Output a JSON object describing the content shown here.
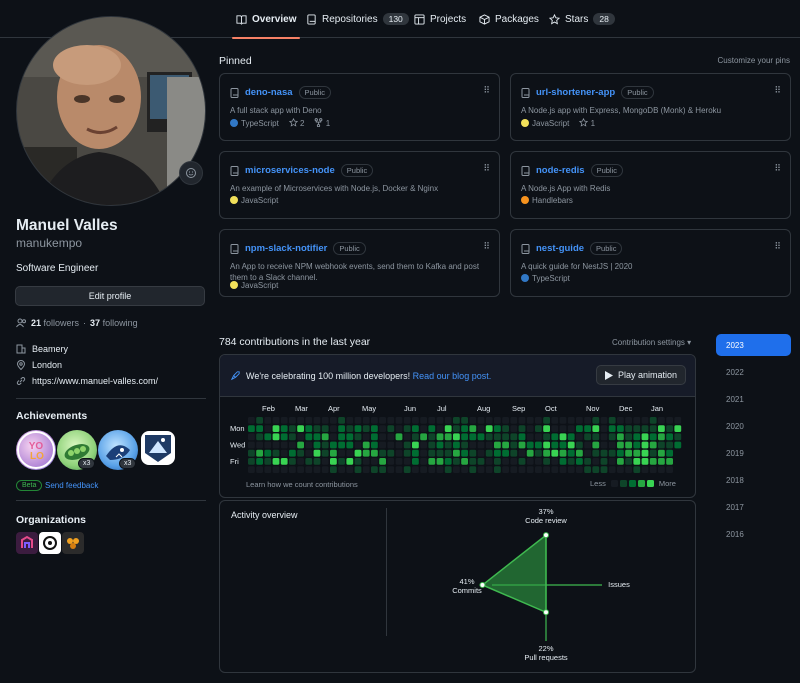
{
  "nav": {
    "tabs": [
      {
        "label": "Overview",
        "icon": "book-icon",
        "active": true
      },
      {
        "label": "Repositories",
        "icon": "repo-icon",
        "count": "130"
      },
      {
        "label": "Projects",
        "icon": "table-icon"
      },
      {
        "label": "Packages",
        "icon": "package-icon"
      },
      {
        "label": "Stars",
        "icon": "star-icon",
        "count": "28"
      }
    ]
  },
  "profile": {
    "fullname": "Manuel Valles",
    "username": "manukempo",
    "bio": "Software Engineer",
    "edit_label": "Edit profile",
    "followers_count": "21",
    "followers_label": "followers",
    "dot": "·",
    "following_count": "37",
    "following_label": "following",
    "company": "Beamery",
    "location": "London",
    "website": "https://www.manuel-valles.com/"
  },
  "achievements": {
    "title": "Achievements",
    "badges": [
      {
        "name": "yolo",
        "mult": ""
      },
      {
        "name": "pair-extraordinaire",
        "mult": "x3"
      },
      {
        "name": "pull-shark",
        "mult": "x3"
      },
      {
        "name": "arctic-code-vault",
        "mult": ""
      }
    ],
    "beta": "Beta",
    "feedback": "Send feedback"
  },
  "organizations": {
    "title": "Organizations"
  },
  "pinned": {
    "title": "Pinned",
    "customize": "Customize your pins",
    "repos": [
      {
        "name": "deno-nasa",
        "visibility": "Public",
        "desc": "A full stack app with Deno",
        "lang": "TypeScript",
        "color": "#3178c6",
        "stars": "2",
        "forks": "1"
      },
      {
        "name": "url-shortener-app",
        "visibility": "Public",
        "desc": "A Node.js app with Express, MongoDB (Monk) & Heroku",
        "lang": "JavaScript",
        "color": "#f1e05a",
        "stars": "1",
        "forks": ""
      },
      {
        "name": "microservices-node",
        "visibility": "Public",
        "desc": "An example of Microservices with Node.js, Docker & Nginx",
        "lang": "JavaScript",
        "color": "#f1e05a",
        "stars": "",
        "forks": ""
      },
      {
        "name": "node-redis",
        "visibility": "Public",
        "desc": "A Node.js App with Redis",
        "lang": "Handlebars",
        "color": "#f7931e",
        "stars": "",
        "forks": ""
      },
      {
        "name": "npm-slack-notifier",
        "visibility": "Public",
        "desc": "An App to receive NPM webhook events, send them to Kafka and post them to a Slack channel.",
        "lang": "JavaScript",
        "color": "#f1e05a",
        "stars": "",
        "forks": ""
      },
      {
        "name": "nest-guide",
        "visibility": "Public",
        "desc": "A quick guide for NestJS | 2020",
        "lang": "TypeScript",
        "color": "#3178c6",
        "stars": "",
        "forks": ""
      }
    ]
  },
  "contributions": {
    "title": "784 contributions in the last year",
    "settings": "Contribution settings ▾",
    "celebrate_text": "We're celebrating 100 million developers!",
    "celebrate_link": "Read our blog post.",
    "play_label": "Play animation",
    "months": [
      "Feb",
      "Mar",
      "Apr",
      "May",
      "Jun",
      "Jul",
      "Aug",
      "Sep",
      "Oct",
      "Nov",
      "Dec",
      "Jan"
    ],
    "days": [
      "Mon",
      "Wed",
      "Fri"
    ],
    "learn": "Learn how we count contributions",
    "less": "Less",
    "more": "More",
    "levels": [
      "#161b22",
      "#0e4429",
      "#006d32",
      "#26a641",
      "#39d353"
    ]
  },
  "activity": {
    "title": "Activity overview",
    "code_review": {
      "pct": "37%",
      "label": "Code review",
      "value": 0.37
    },
    "commits": {
      "pct": "41%",
      "label": "Commits",
      "value": 0.41
    },
    "pull_requests": {
      "pct": "22%",
      "label": "Pull requests",
      "value": 0.22
    },
    "issues": {
      "label": "Issues",
      "value": 0
    }
  },
  "years": [
    "2023",
    "2022",
    "2021",
    "2020",
    "2019",
    "2018",
    "2017",
    "2016"
  ]
}
